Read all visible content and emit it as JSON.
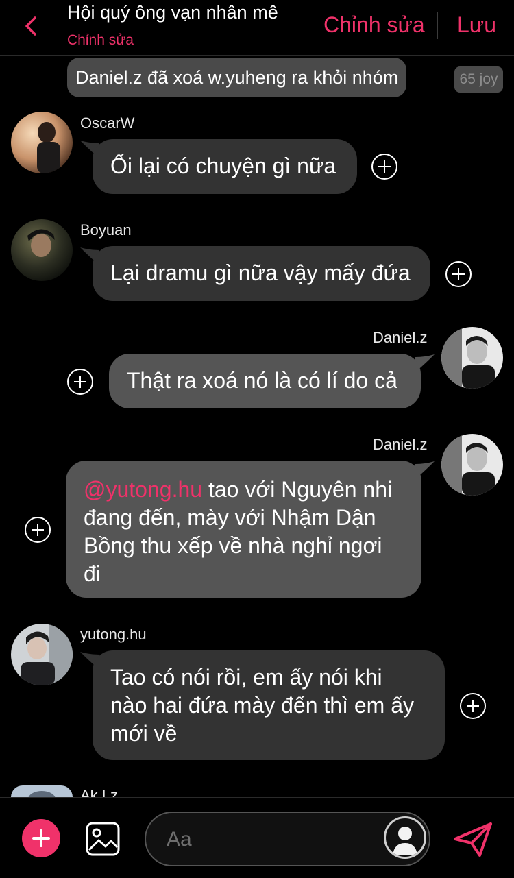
{
  "header": {
    "title": "Hội quý ông vạn nhân mê",
    "subtitle": "Chỉnh sửa",
    "edit_label": "Chỉnh sửa",
    "save_label": "Lưu"
  },
  "system_message": {
    "text": "Daniel.z đã xoá w.yuheng ra khỏi nhóm",
    "badge": "65 joy"
  },
  "messages": [
    {
      "sender": "OscarW",
      "direction": "incoming",
      "lines": [
        "Ối lại có chuyện gì nữa"
      ]
    },
    {
      "sender": "Boyuan",
      "direction": "incoming",
      "lines": [
        "Lại dramu gì nữa vậy mấy đứa"
      ]
    },
    {
      "sender": "Daniel.z",
      "direction": "outgoing",
      "lines": [
        "Thật ra xoá nó là có lí do cả"
      ]
    },
    {
      "sender": "Daniel.z",
      "direction": "outgoing",
      "mention": "@yutong.hu",
      "line1_rest": " tao với Nguyên nhi",
      "lines": [
        "đang đến, mày với Nhậm Dận",
        "Bồng thu xếp về nhà nghỉ ngơi",
        "đi"
      ]
    },
    {
      "sender": "yutong.hu",
      "direction": "incoming",
      "lines": [
        "Tao có nói rồi, em ấy nói khi",
        "nào hai đứa mày đến thì em ấy",
        "mới về"
      ]
    }
  ],
  "partial_sender": "Ak.Lz",
  "composer": {
    "placeholder": "Aa"
  },
  "icons": {
    "back": "chevron-left-icon",
    "add": "plus-icon",
    "image": "image-icon",
    "send": "send-icon",
    "react": "plus-circle-icon"
  },
  "colors": {
    "accent": "#f0326a",
    "incoming_bubble": "#333333",
    "outgoing_bubble": "#555555",
    "background": "#000000"
  }
}
